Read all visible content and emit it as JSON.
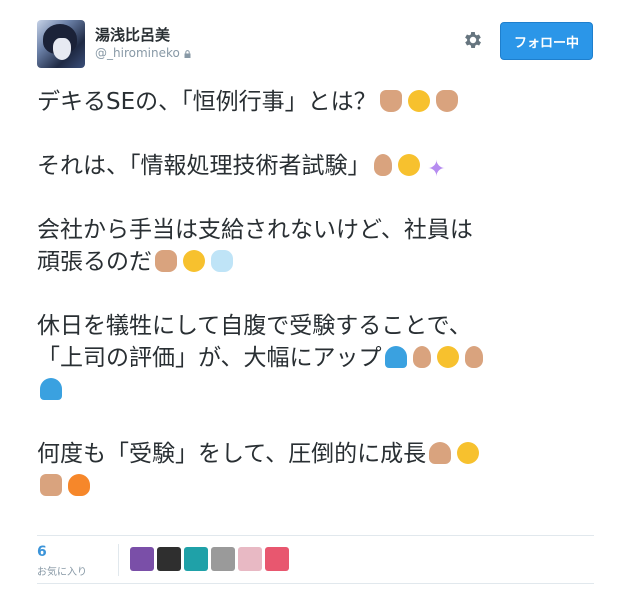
{
  "user": {
    "display_name": "湯浅比呂美",
    "handle": "@_hiromineko",
    "protected_icon": "lock-icon"
  },
  "header": {
    "gear_icon": "gear-icon",
    "follow_button_label": "フォロー中",
    "accent_color": "#2b96e8"
  },
  "tweet": {
    "line1": "デキるSEの、「恒例行事」とは？",
    "line2": "それは、「情報処理技術者試験」",
    "line3": "会社から手当は支給されないけど、社員は",
    "line4": "頑張るのだ",
    "line5": "休日を犠牲にして自腹で受験することで、",
    "line6": "「上司の評価」が、大幅にアップ",
    "line7": "何度も「受験」をして、圧倒的に成長"
  },
  "stats": {
    "favorites_count": "6",
    "favorites_label": "お気に入り"
  },
  "favoriters": [
    {
      "name": "favoriter-avatar-1",
      "color": "#7a4fa8"
    },
    {
      "name": "favoriter-avatar-2",
      "color": "#2f2f2f"
    },
    {
      "name": "favoriter-avatar-3",
      "color": "#1fa1a8"
    },
    {
      "name": "favoriter-avatar-4",
      "color": "#9a9a9a"
    },
    {
      "name": "favoriter-avatar-5",
      "color": "#e8b9c4"
    },
    {
      "name": "favoriter-avatar-6",
      "color": "#e8576f"
    }
  ]
}
